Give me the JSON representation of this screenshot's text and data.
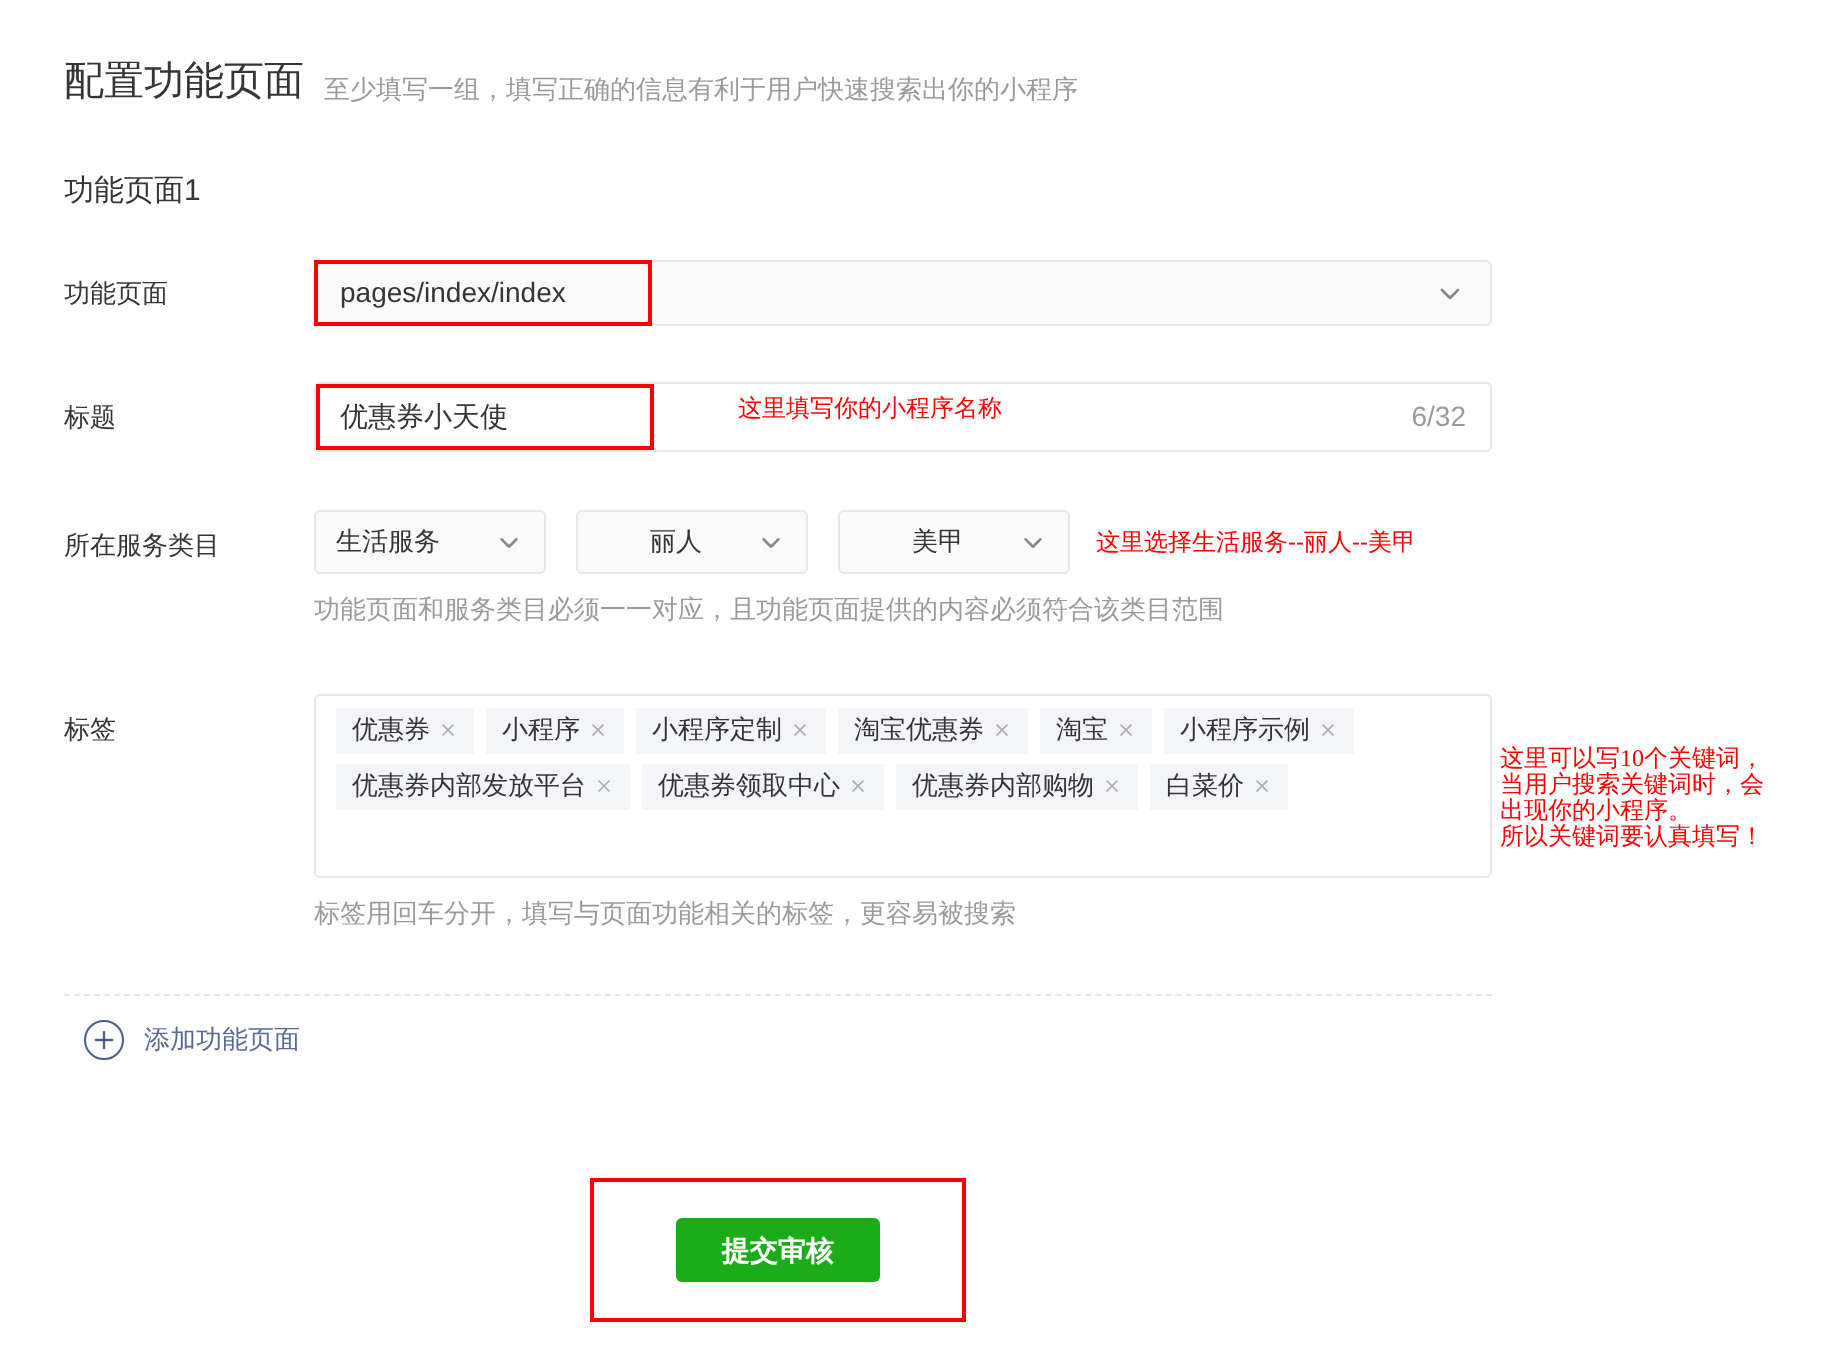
{
  "header": {
    "title": "配置功能页面",
    "subtitle": "至少填写一组，填写正确的信息有利于用户快速搜索出你的小程序"
  },
  "section": {
    "title": "功能页面1"
  },
  "page_field": {
    "label": "功能页面",
    "value": "pages/index/index"
  },
  "title_field": {
    "label": "标题",
    "value": "优惠券小天使",
    "count": "6/32",
    "note": "这里填写你的小程序名称"
  },
  "category": {
    "label": "所在服务类目",
    "selects": [
      "生活服务",
      "丽人",
      "美甲"
    ],
    "note": "这里选择生活服务--丽人--美甲",
    "hint": "功能页面和服务类目必须一一对应，且功能页面提供的内容必须符合该类目范围"
  },
  "tags": {
    "label": "标签",
    "items": [
      "优惠券",
      "小程序",
      "小程序定制",
      "淘宝优惠券",
      "淘宝",
      "小程序示例",
      "优惠券内部发放平台",
      "优惠券领取中心",
      "优惠券内部购物",
      "白菜价"
    ],
    "note": [
      "这里可以写10个关键词，",
      "当用户搜索关键词时，会",
      "出现你的小程序。",
      "所以关键词要认真填写！"
    ],
    "hint": "标签用回车分开，填写与页面功能相关的标签，更容易被搜索"
  },
  "add_link": "添加功能页面",
  "submit_button": "提交审核"
}
